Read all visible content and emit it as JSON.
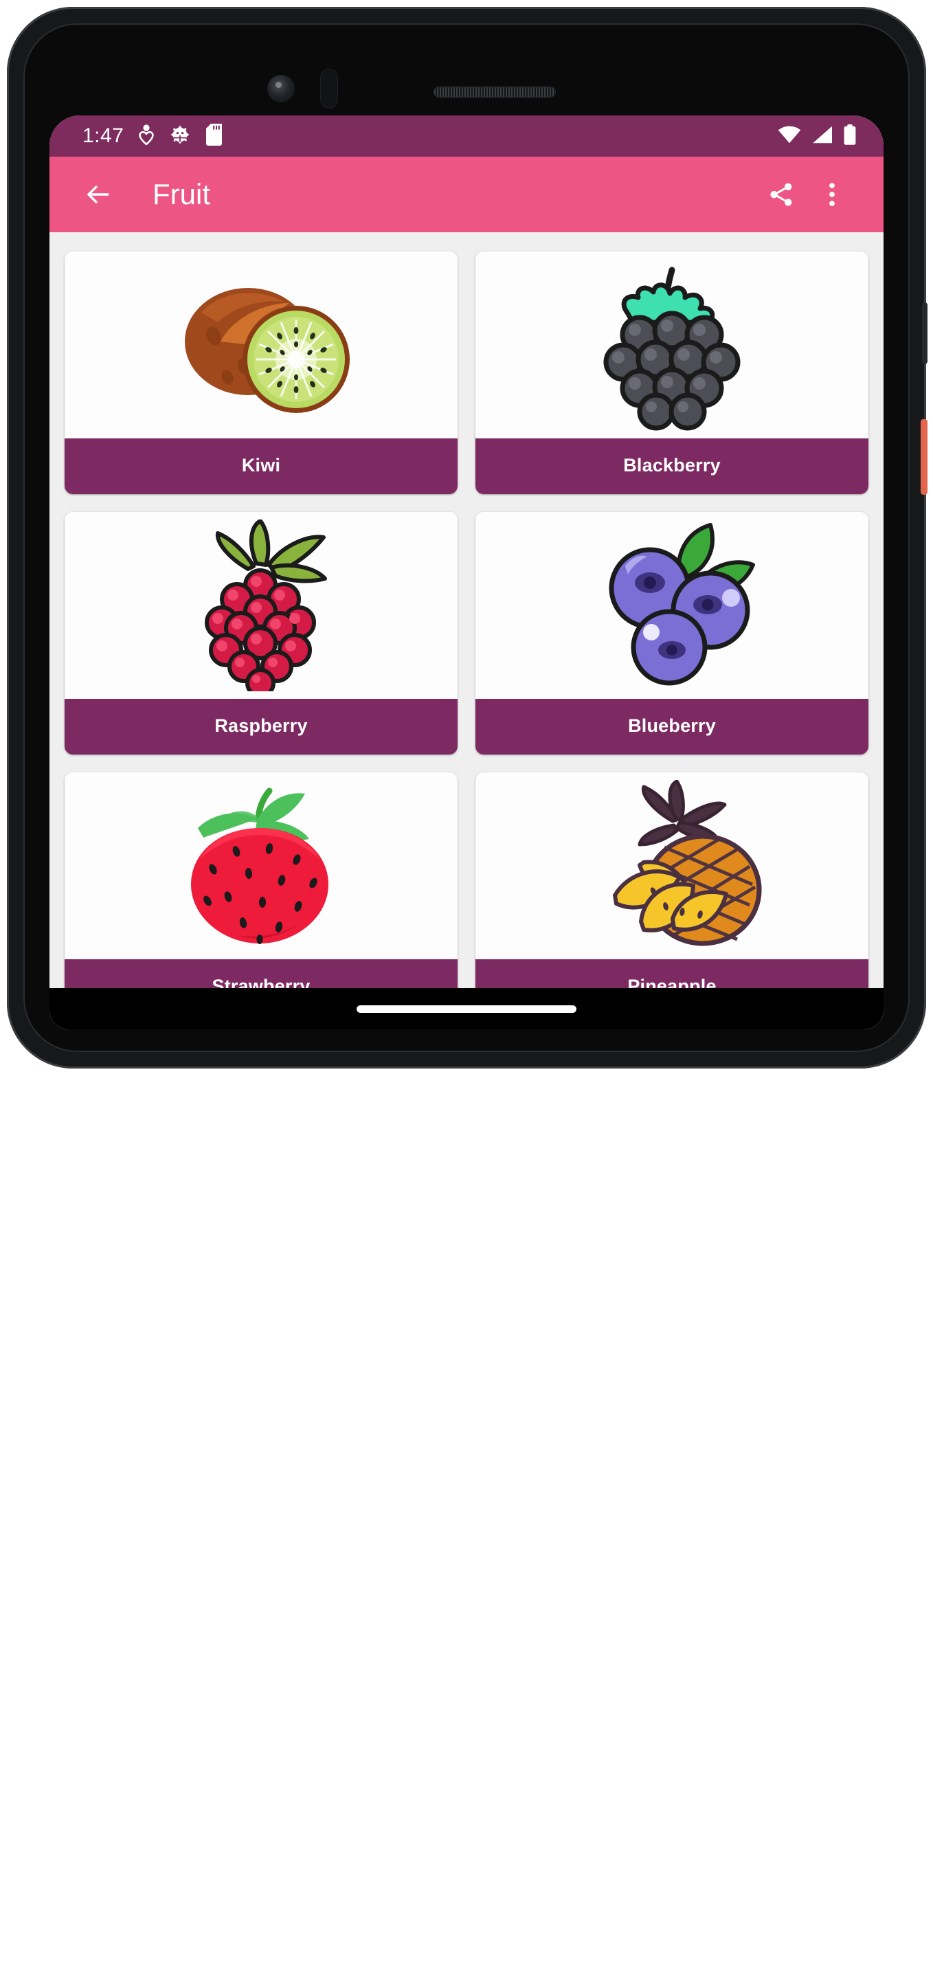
{
  "device": {
    "hardware": {
      "camera_icon": "camera-lens",
      "sensor_icon": "proximity-sensor",
      "speaker_icon": "earpiece-speaker",
      "power_button": "power-button",
      "volume_button": "volume-button"
    }
  },
  "status_bar": {
    "clock": "1:47",
    "background_color": "#7e2c5e",
    "foreground_color": "#ffffff",
    "left_icons": [
      {
        "name": "location-heart-icon"
      },
      {
        "name": "android-debug-bug-icon"
      },
      {
        "name": "sd-card-icon"
      }
    ],
    "right_icons": [
      {
        "name": "wifi-icon"
      },
      {
        "name": "cellular-signal-icon"
      },
      {
        "name": "battery-full-icon"
      }
    ]
  },
  "app_bar": {
    "title": "Fruit",
    "background_color": "#ed5584",
    "foreground_color": "#ffffff",
    "back_label": "Back",
    "share_label": "Share",
    "overflow_label": "More options"
  },
  "content": {
    "background_color": "#efeff0",
    "card_background": "#ffffff",
    "label_background": "#7e2a62",
    "label_color": "#ffffff",
    "items": [
      {
        "label": "Kiwi",
        "icon": "kiwi-icon"
      },
      {
        "label": "Blackberry",
        "icon": "blackberry-icon"
      },
      {
        "label": "Raspberry",
        "icon": "raspberry-icon"
      },
      {
        "label": "Blueberry",
        "icon": "blueberry-icon"
      },
      {
        "label": "Strawberry",
        "icon": "strawberry-icon"
      },
      {
        "label": "Pineapple",
        "icon": "pineapple-icon"
      },
      {
        "label": "",
        "icon": "cherry-icon"
      },
      {
        "label": "",
        "icon": "banana-icon"
      }
    ]
  },
  "nav_bar": {
    "background_color": "#000000",
    "home_handle_label": "Home"
  }
}
